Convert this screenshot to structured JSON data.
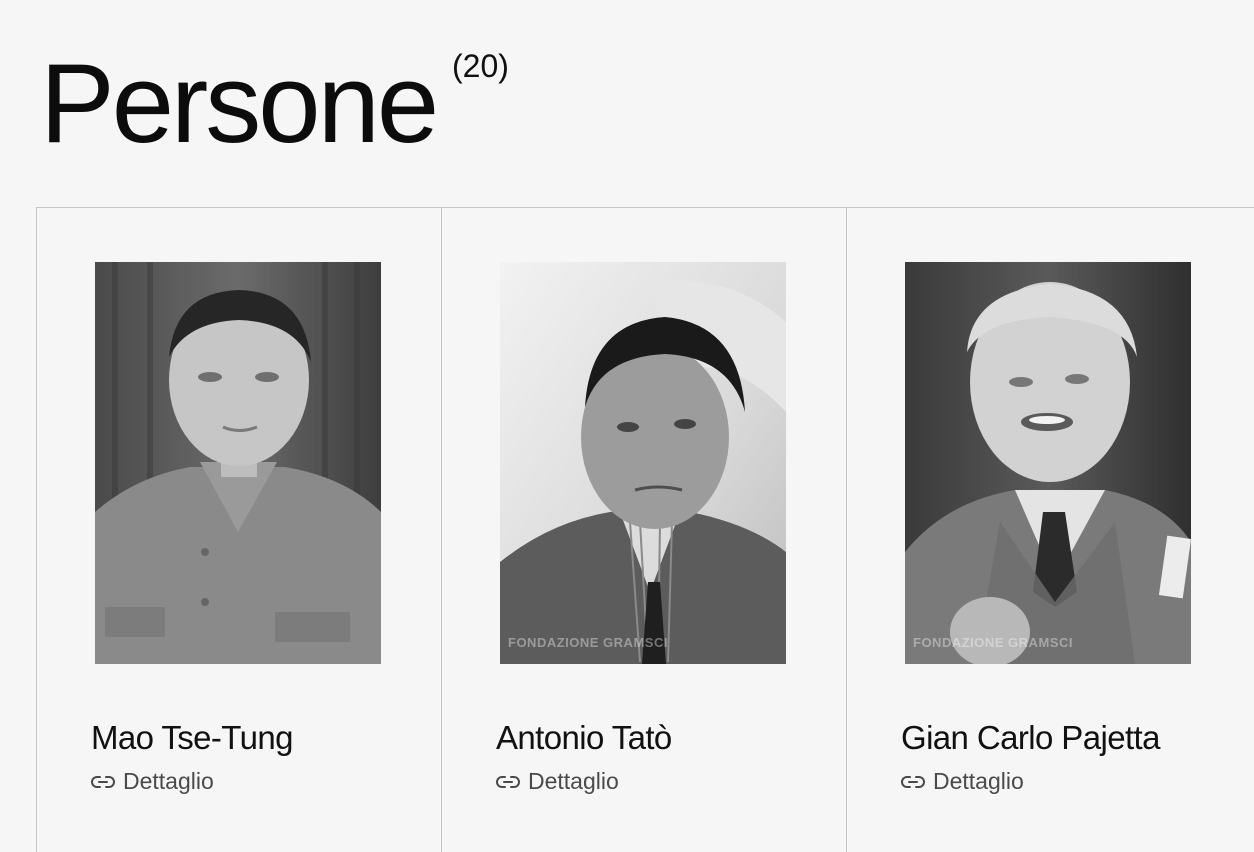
{
  "header": {
    "title": "Persone",
    "count": "(20)"
  },
  "people": [
    {
      "name": "Mao Tse-Tung",
      "detail_label": "Dettaglio",
      "detail_icon": "link-icon"
    },
    {
      "name": "Antonio Tatò",
      "detail_label": "Dettaglio",
      "detail_icon": "link-icon",
      "watermark": "FONDAZIONE GRAMSCI"
    },
    {
      "name": "Gian Carlo Pajetta",
      "detail_label": "Dettaglio",
      "detail_icon": "link-icon",
      "watermark": "FONDAZIONE GRAMSCI"
    }
  ],
  "colors": {
    "background": "#f6f6f6",
    "border": "#c6c6c6",
    "text": "#111111",
    "muted_text": "#4a4a4a"
  }
}
